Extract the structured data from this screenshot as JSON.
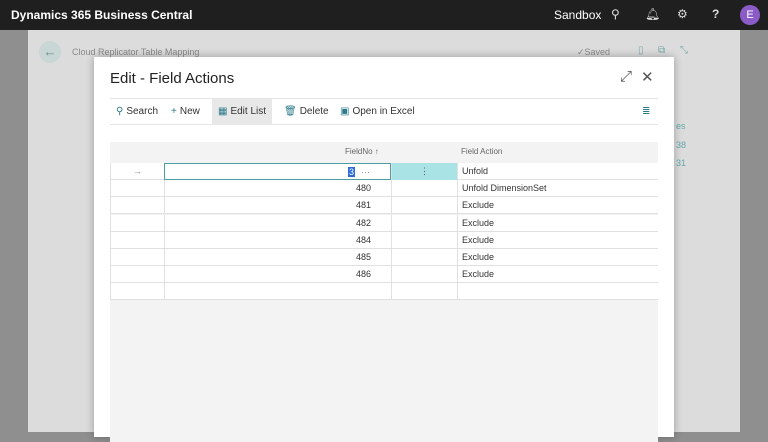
{
  "topbar": {
    "brand": "Dynamics 365 Business Central",
    "environment": "Sandbox",
    "avatar": "E"
  },
  "background_page": {
    "title": "Cloud Replicator Table Mapping",
    "status": "✓Saved",
    "fragments": [
      "es",
      "38",
      "31"
    ]
  },
  "dialog": {
    "title": "Edit - Field Actions",
    "toolbar": {
      "search": "Search",
      "new": "New",
      "edit_list": "Edit List",
      "delete": "Delete",
      "open_excel": "Open in Excel"
    },
    "columns": {
      "field_no": "FieldNo ↑",
      "field_action": "Field Action"
    },
    "rows": [
      {
        "field_no": "3",
        "action": "Unfold",
        "selected": true
      },
      {
        "field_no": "480",
        "action": "Unfold DimensionSet"
      },
      {
        "field_no": "481",
        "action": "Exclude"
      },
      {
        "field_no": "482",
        "action": "Exclude"
      },
      {
        "field_no": "484",
        "action": "Exclude"
      },
      {
        "field_no": "485",
        "action": "Exclude"
      },
      {
        "field_no": "486",
        "action": "Exclude"
      },
      {
        "field_no": "",
        "action": ""
      }
    ]
  }
}
